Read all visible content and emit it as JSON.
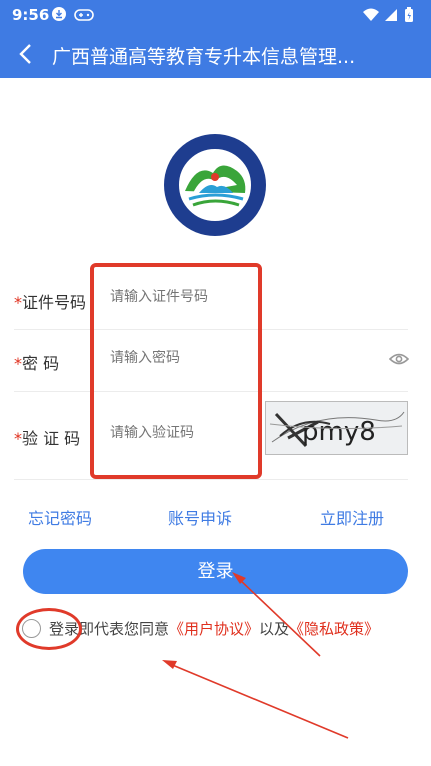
{
  "status_bar": {
    "time": "9:56"
  },
  "title_bar": {
    "title": "广西普通高等教育专升本信息管理..."
  },
  "form": {
    "id_label": "证件号码",
    "id_placeholder": "请输入证件号码",
    "password_label": "密 码",
    "password_placeholder": "请输入密码",
    "captcha_label": "验 证 码",
    "captcha_placeholder": "请输入验证码",
    "required_mark": "*"
  },
  "links": {
    "forgot": "忘记密码",
    "appeal": "账号申诉",
    "register": "立即注册"
  },
  "login_button": "登录",
  "agreement": {
    "prefix": "登录即代表您同意",
    "user_agreement": "《用户协议》",
    "middle": "以及",
    "privacy_policy": "《隐私政策》"
  },
  "colors": {
    "brand_blue": "#3f7be3",
    "button_blue": "#3f86f0",
    "annotation_red": "#e03a2a",
    "required_red": "#e0301e"
  }
}
